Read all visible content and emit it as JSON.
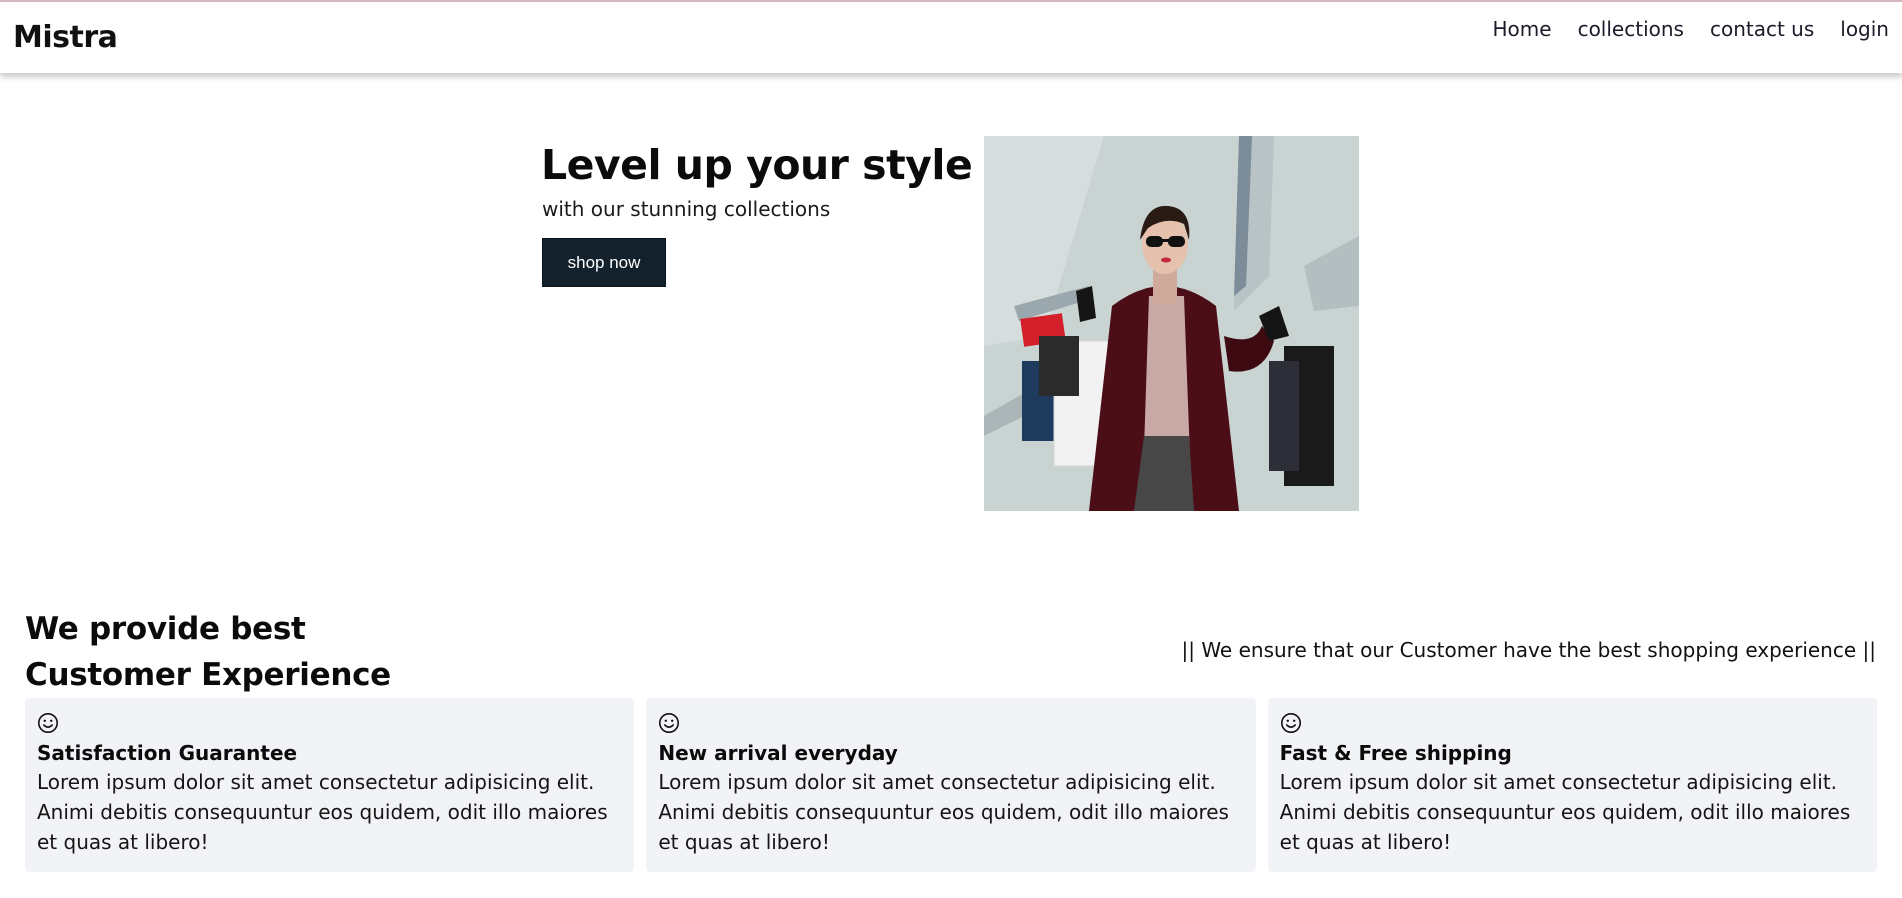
{
  "nav": {
    "brand": "Mistra",
    "links": [
      "Home",
      "collections",
      "contact us",
      "login"
    ]
  },
  "hero": {
    "title": "Level up your style",
    "subtitle": "with our stunning collections",
    "button_label": "shop now"
  },
  "section": {
    "title_line1": "We provide best",
    "title_line2": "Customer Experience",
    "tagline": "|| We ensure that our Customer have the best shopping experience ||"
  },
  "cards": [
    {
      "icon": "smiley-icon",
      "title": "Satisfaction Guarantee",
      "text": "Lorem ipsum dolor sit amet consectetur adipisicing elit. Animi debitis consequuntur eos quidem, odit illo maiores et quas at libero!"
    },
    {
      "icon": "smiley-icon",
      "title": "New arrival everyday",
      "text": "Lorem ipsum dolor sit amet consectetur adipisicing elit. Animi debitis consequuntur eos quidem, odit illo maiores et quas at libero!"
    },
    {
      "icon": "smiley-icon",
      "title": "Fast & Free shipping",
      "text": "Lorem ipsum dolor sit amet consectetur adipisicing elit. Animi debitis consequuntur eos quidem, odit illo maiores et quas at libero!"
    }
  ],
  "colors": {
    "button_bg": "#12212c",
    "card_bg": "#f1f3f6"
  }
}
